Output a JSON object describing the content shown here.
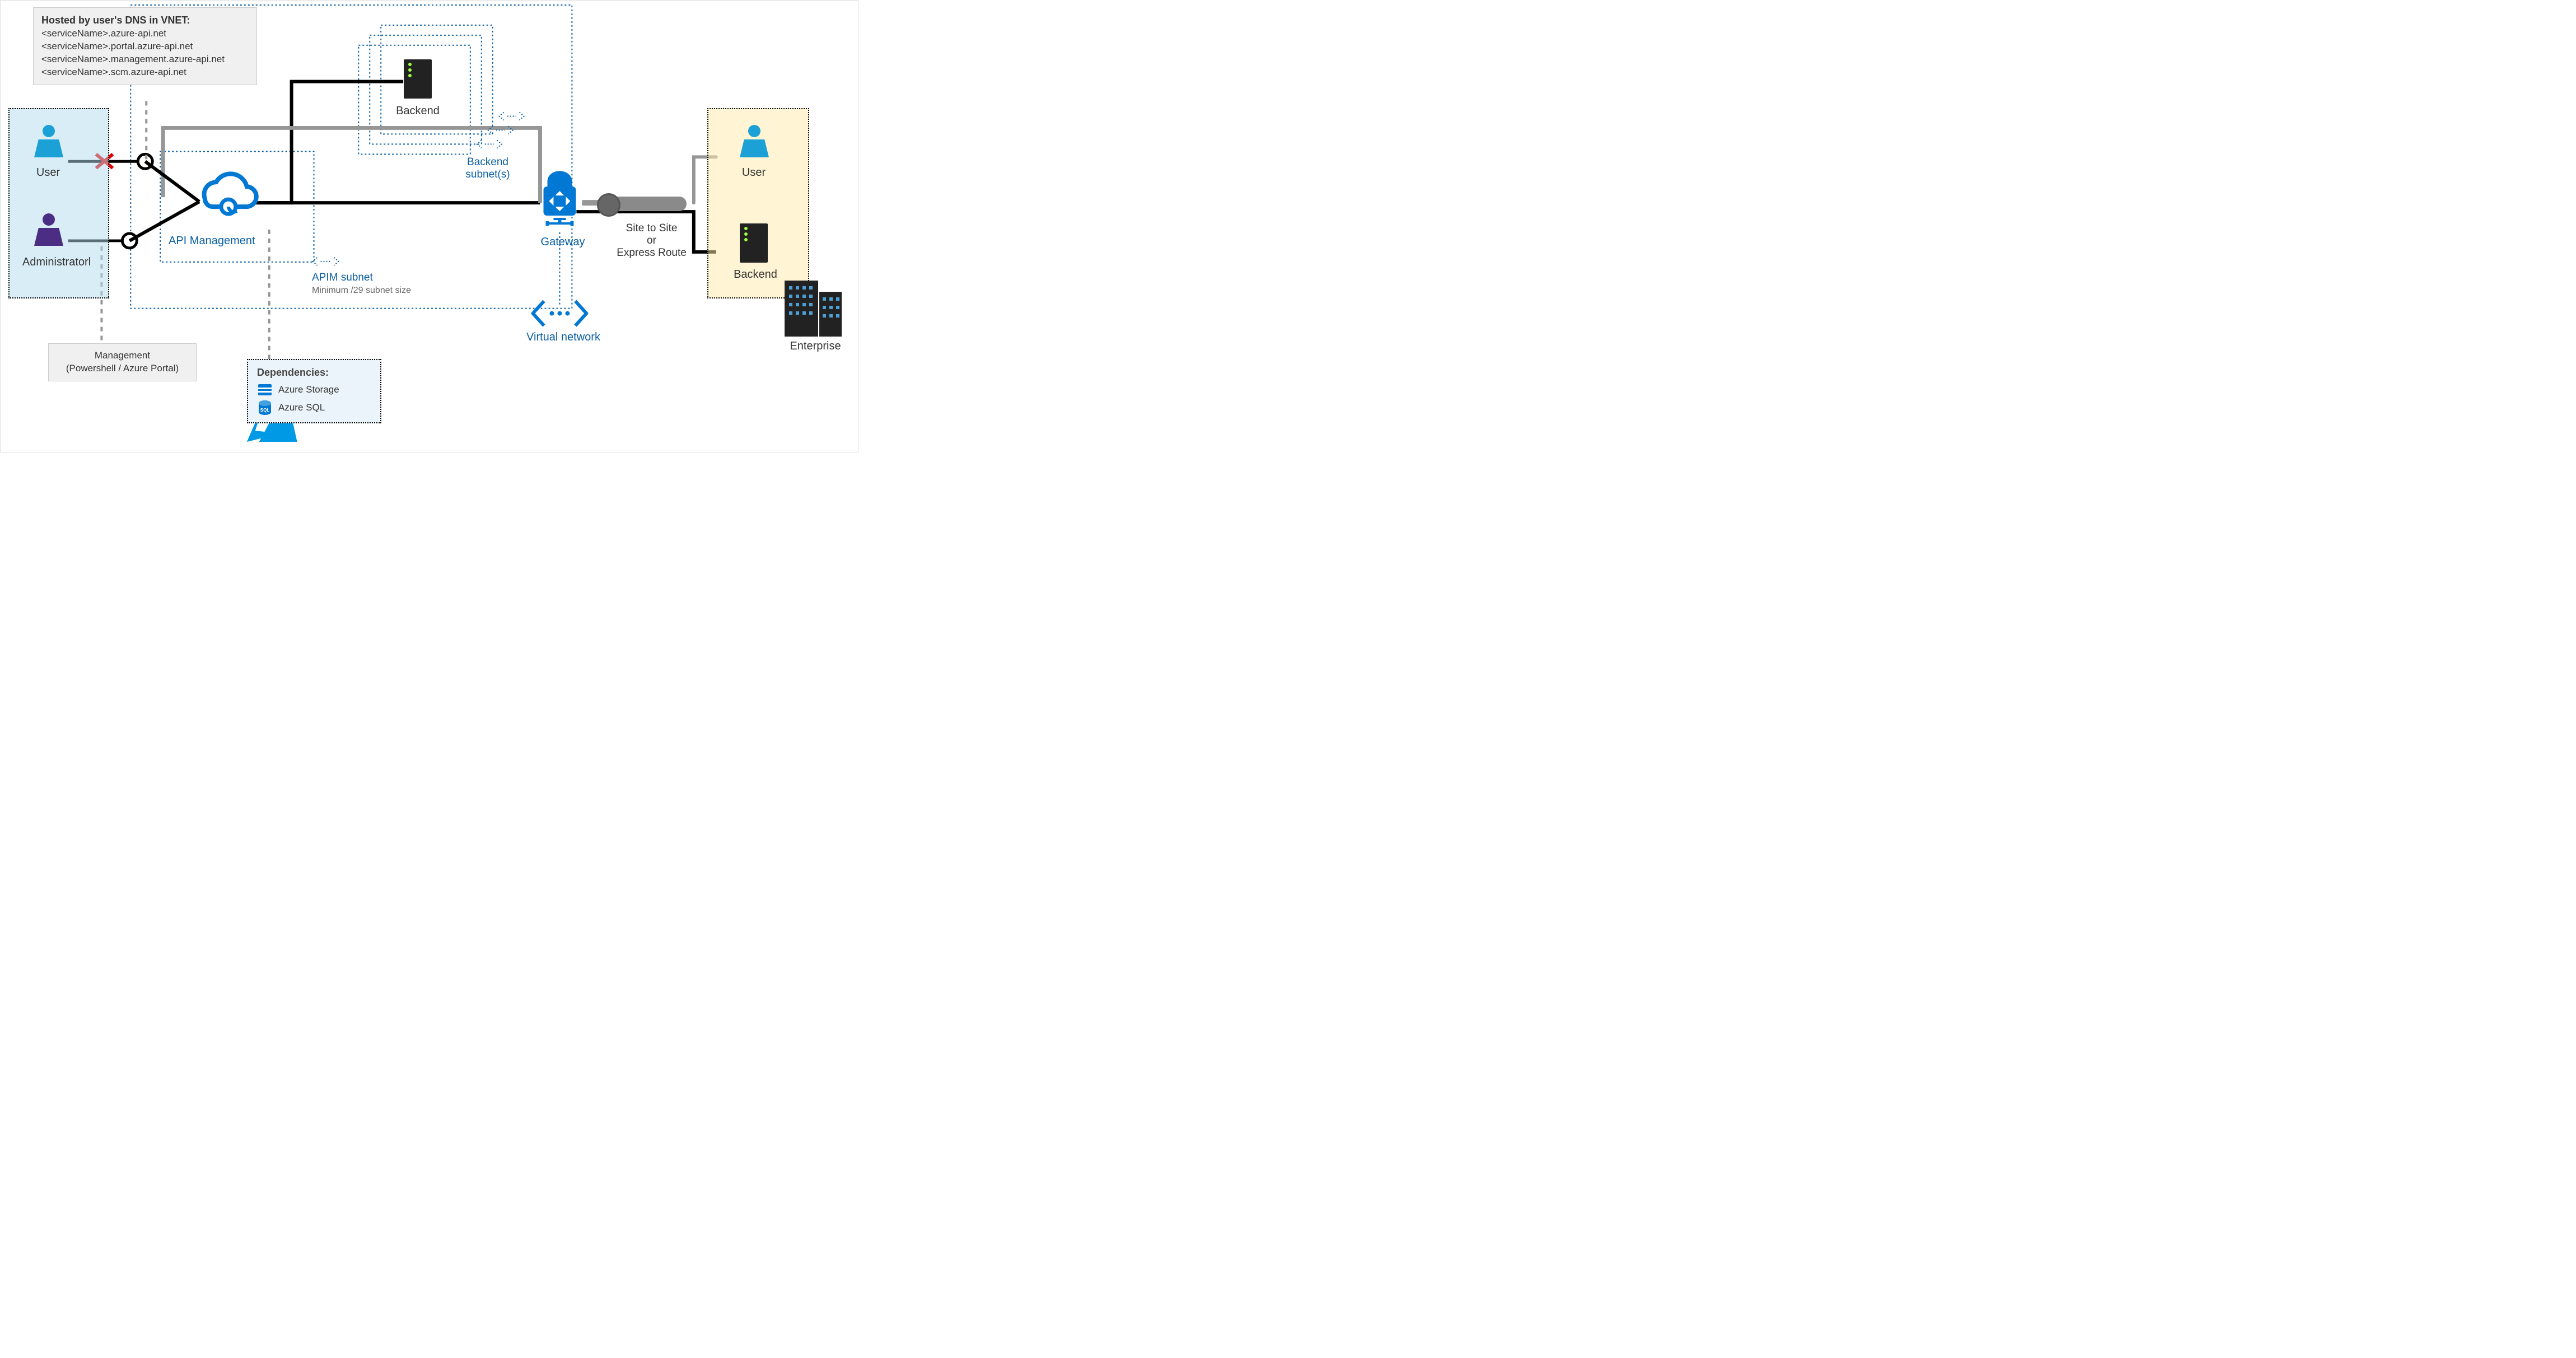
{
  "dns_box": {
    "title": "Hosted by user's DNS in VNET:",
    "line1": "<serviceName>.azure-api.net",
    "line2": "<serviceName>.portal.azure-api.net",
    "line3": "<serviceName>.management.azure-api.net",
    "line4": "<serviceName>.scm.azure-api.net"
  },
  "left_panel": {
    "user_label": "User",
    "admin_label": "Administratorl"
  },
  "mgmt_box": "Management\n(Powershell / Azure Portal)",
  "apim": {
    "label": "API Management",
    "subnet_label": "APIM subnet",
    "subnet_note": "Minimum /29 subnet size"
  },
  "backend": {
    "label": "Backend",
    "subnets_label": "Backend\nsubnet(s)"
  },
  "gateway": "Gateway",
  "vnet_label": "Virtual network",
  "link_label": "Site to Site\nor\nExpress Route",
  "enterprise": {
    "label": "Enterprise",
    "user_label": "User",
    "backend_label": "Backend"
  },
  "dependencies": {
    "title": "Dependencies:",
    "item1": "Azure Storage",
    "item2": "Azure SQL"
  },
  "colors": {
    "blue": "#0a5fa3",
    "azureblue": "#0078d4",
    "grey": "#8a8a8a"
  }
}
